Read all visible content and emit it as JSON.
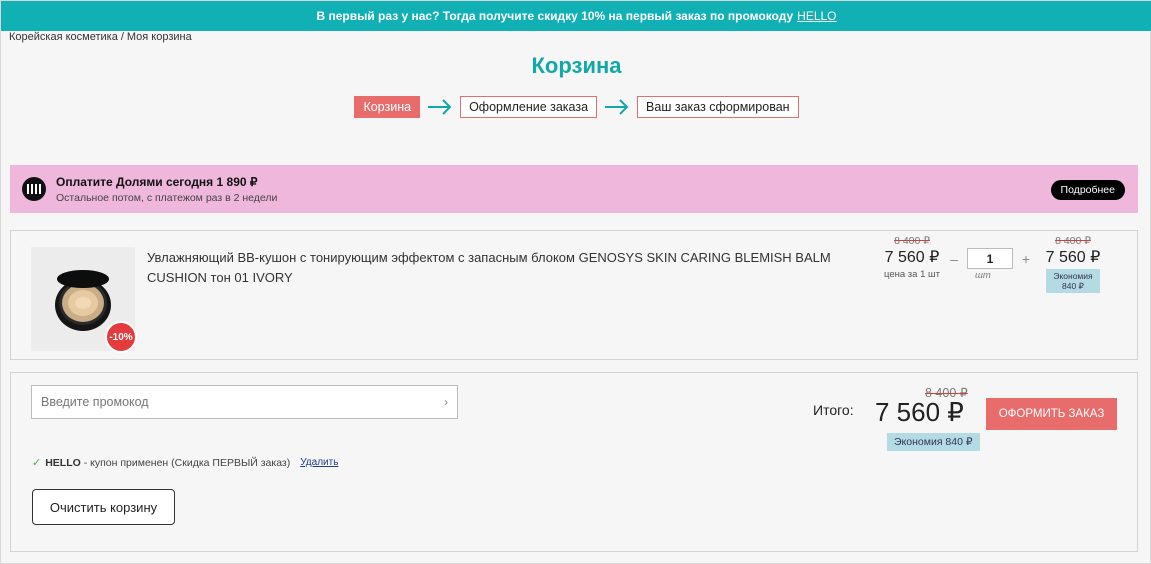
{
  "banner": {
    "text": "В первый раз у нас? Тогда получите скидку 10% на первый заказ по промокоду",
    "code": "HELLO"
  },
  "breadcrumb": [
    {
      "label": "Корейская косметика"
    },
    {
      "label": "Моя корзина"
    }
  ],
  "breadcrumb_sep": "/",
  "page_title": "Корзина",
  "steps": [
    {
      "label": "Корзина"
    },
    {
      "label": "Оформление заказа"
    },
    {
      "label": "Ваш заказ сформирован"
    }
  ],
  "dolyami": {
    "title": "Оплатите Долями сегодня 1 890 ₽",
    "subtitle": "Остальное потом, с платежом раз в 2 недели",
    "more_label": "Подробнее"
  },
  "cart_item": {
    "name": "Увлажняющий ВВ-кушон с тонирующим эффектом с запасным блоком GENOSYS SKIN CARING BLEMISH BALM CUSHION тон 01 IVORY",
    "discount_badge": "-10%",
    "unit_old_price": "8 400 ₽",
    "unit_price": "7 560 ₽",
    "unit_caption": "цена за 1 шт",
    "qty_minus": "–",
    "qty": "1",
    "qty_plus": "+",
    "qty_caption": "шт",
    "total_old_price": "8 400 ₽",
    "total_price": "7 560 ₽",
    "economy": "Экономия 840 ₽"
  },
  "promo": {
    "placeholder": "Введите промокод",
    "chevron": "›",
    "check": "✓",
    "applied_code": "HELLO",
    "applied_text": " - купон применен (Скидка ПЕРВЫЙ заказ)",
    "remove_label": "Удалить"
  },
  "clear_label": "Очистить корзину",
  "summary": {
    "label": "Итого:",
    "old_price": "8 400 ₽",
    "price": "7 560 ₽",
    "economy": "Экономия 840 ₽",
    "checkout_label": "ОФОРМИТЬ ЗАКАЗ"
  },
  "colors": {
    "accent": "#10b0b5",
    "cta": "#e96c6c",
    "dolyami_bg": "#efb7dc",
    "economy_bg": "#b4dbe3"
  }
}
